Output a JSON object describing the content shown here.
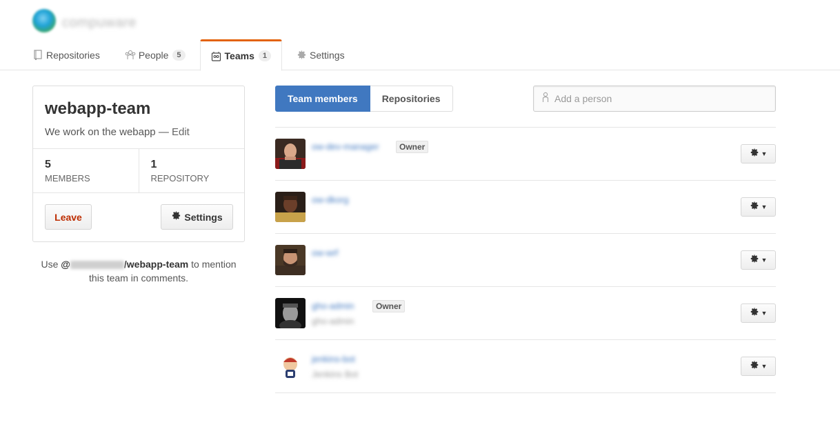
{
  "org": {
    "name": "compuware"
  },
  "tabs": [
    {
      "label": "Repositories",
      "icon": "repo-icon",
      "count": ""
    },
    {
      "label": "People",
      "icon": "people-icon",
      "count": "5"
    },
    {
      "label": "Teams",
      "icon": "teams-icon",
      "count": "1",
      "selected": true
    },
    {
      "label": "Settings",
      "icon": "gear-icon",
      "count": ""
    }
  ],
  "team": {
    "name": "webapp-team",
    "description": "We work on the webapp",
    "edit_label": "Edit",
    "members_count": "5",
    "members_label": "MEMBERS",
    "repos_count": "1",
    "repos_label": "REPOSITORY",
    "leave_label": "Leave",
    "settings_label": "Settings"
  },
  "mention": {
    "prefix": "Use",
    "at": "@",
    "org_blurred": "compuware",
    "handle": "/webapp-team",
    "suffix1": "to mention",
    "suffix2": "this team in comments."
  },
  "main": {
    "tab_members": "Team members",
    "tab_repositories": "Repositories",
    "add_person_placeholder": "Add a person"
  },
  "members": [
    {
      "login": "ow-dev-manager",
      "fullname": "",
      "owner": "Owner",
      "avatar": "picard"
    },
    {
      "login": "ow-dkorg",
      "fullname": "",
      "owner": "",
      "avatar": "worf"
    },
    {
      "login": "ow-wrf",
      "fullname": "",
      "owner": "",
      "avatar": "riker"
    },
    {
      "login": "gho-admin",
      "fullname": "gho-admin",
      "owner": "Owner",
      "avatar": "harrison"
    },
    {
      "login": "jenkins-bot",
      "fullname": "Jenkins Bot",
      "owner": "",
      "avatar": "jenkins"
    }
  ],
  "colors": {
    "accent": "#4078c0",
    "tab_highlight": "#e36209",
    "danger": "#bd2c00"
  }
}
